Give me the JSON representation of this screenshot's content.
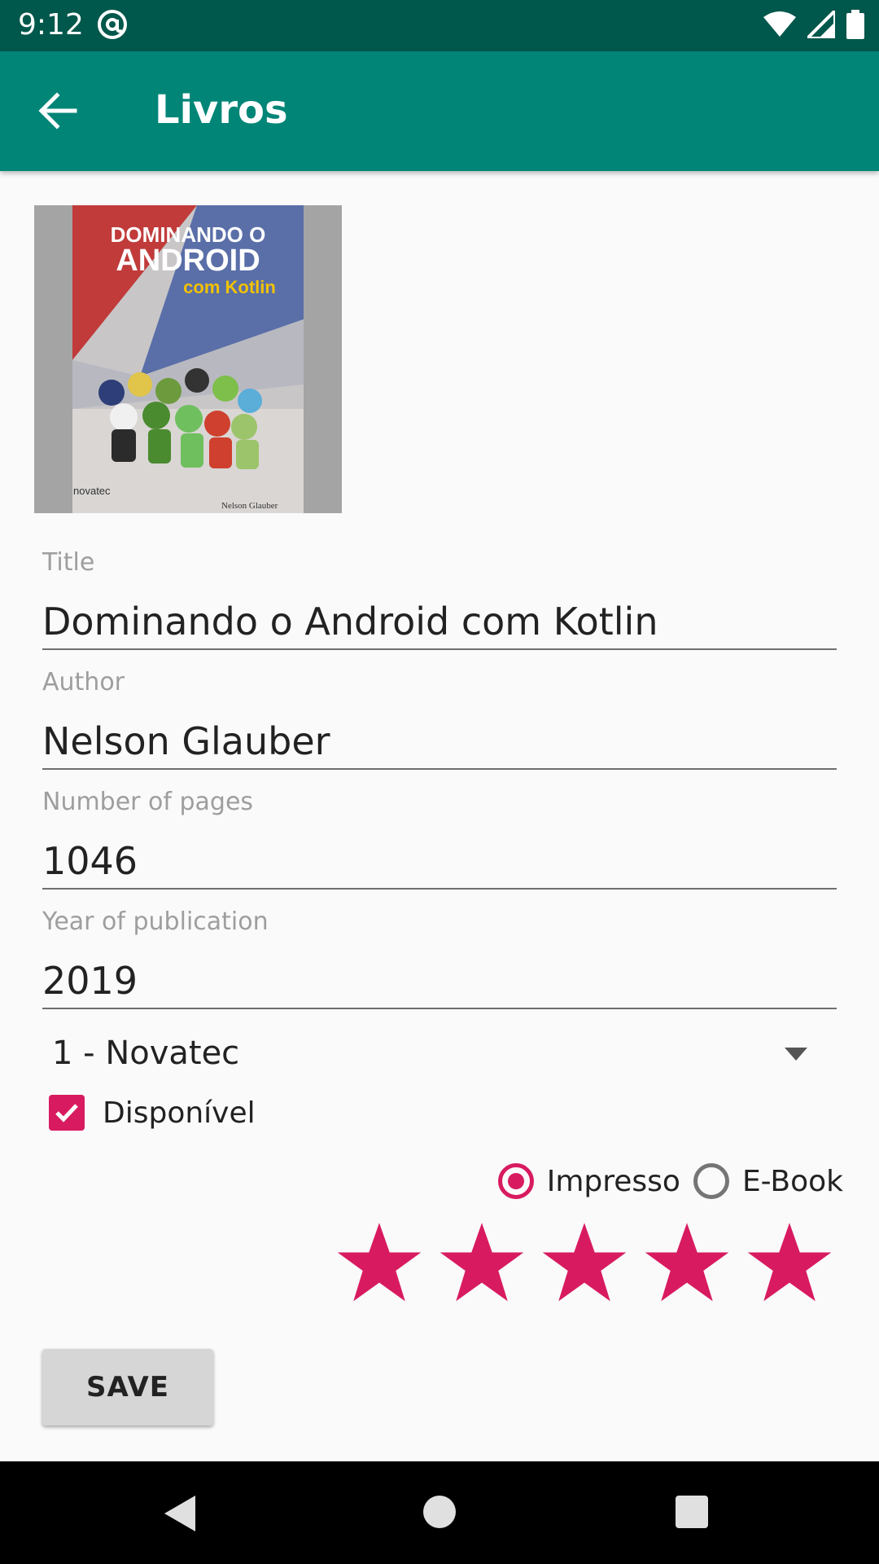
{
  "status_bar": {
    "time": "9:12",
    "icons": [
      "at-sign-icon",
      "wifi-icon",
      "cell-signal-icon",
      "battery-icon"
    ]
  },
  "app_bar": {
    "title": "Livros",
    "back_icon": "arrow-back-icon"
  },
  "cover": {
    "line1": "DOMINANDO O",
    "line2": "ANDROID",
    "line3": "com Kotlin",
    "publisher": "novatec",
    "author": "Nelson Glauber"
  },
  "form": {
    "title_label": "Title",
    "title_value": "Dominando o Android com Kotlin",
    "author_label": "Author",
    "author_value": "Nelson Glauber",
    "pages_label": "Number of pages",
    "pages_value": "1046",
    "year_label": "Year of publication",
    "year_value": "2019",
    "publisher_selected": "1 - Novatec",
    "available_label": "Disponível",
    "available_checked": true,
    "format_options": [
      "Impresso",
      "E-Book"
    ],
    "format_selected": "Impresso",
    "rating": 5,
    "rating_max": 5
  },
  "actions": {
    "save_label": "SAVE"
  },
  "colors": {
    "primary": "#008577",
    "primary_dark": "#00574b",
    "accent": "#d81b60"
  }
}
